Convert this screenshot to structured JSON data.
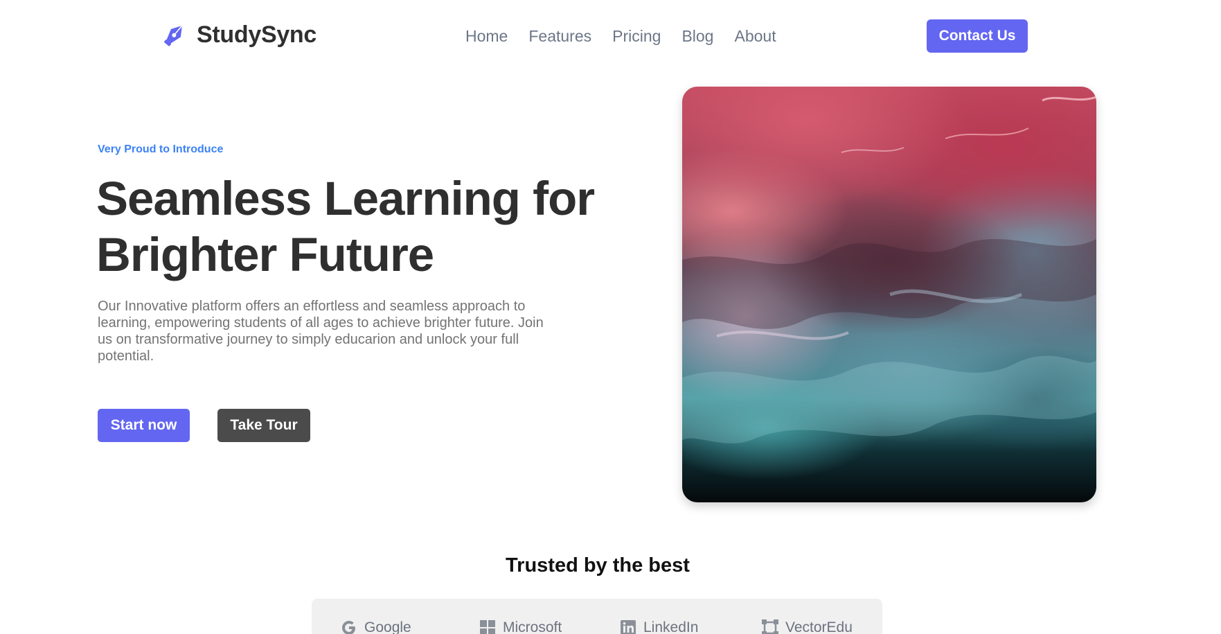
{
  "header": {
    "brand": "StudySync",
    "logo_icon": "pen-nib-icon",
    "nav": [
      "Home",
      "Features",
      "Pricing",
      "Blog",
      "About"
    ],
    "contact_label": "Contact Us"
  },
  "hero": {
    "eyebrow": "Very Proud to Introduce",
    "title_line1": "Seamless Learning for",
    "title_line2": "Brighter Future",
    "description": "Our Innovative platform offers an effortless and seamless approach to learning, empowering students of all ages to achieve brighter future. Join us on transformative journey to simply educarion and unlock your full potential.",
    "primary_label": "Start now",
    "secondary_label": "Take Tour"
  },
  "trusted": {
    "title": "Trusted by the best",
    "brands": [
      {
        "name": "Google",
        "icon": "google-icon"
      },
      {
        "name": "Microsoft",
        "icon": "microsoft-icon"
      },
      {
        "name": "LinkedIn",
        "icon": "linkedin-icon"
      },
      {
        "name": "VectorEdu",
        "icon": "vector-icon"
      }
    ]
  },
  "colors": {
    "accent": "#6366f1",
    "eyebrow": "#3b82f6",
    "heading": "#2f2f2f",
    "secondary_button": "#4b4b4b",
    "nav_text": "#6c7687"
  }
}
